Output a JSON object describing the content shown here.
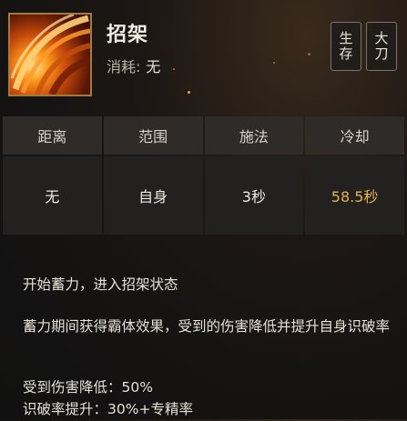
{
  "skill": {
    "name": "招架",
    "cost_label": "消耗:",
    "cost_value": "无",
    "icon": "parry-blade-icon"
  },
  "tags": [
    "生存",
    "大刀"
  ],
  "stats": {
    "headers": [
      "距离",
      "范围",
      "施法",
      "冷却"
    ],
    "values": [
      "无",
      "自身",
      "3秒",
      "58.5秒"
    ]
  },
  "description": {
    "line1": "开始蓄力，进入招架状态",
    "line2": "蓄力期间获得霸体效果，受到的伤害降低并提升自身识破率",
    "line3": "受到伤害降低：50%",
    "line4": "识破率提升：30%+专精率"
  },
  "colors": {
    "cooldown_highlight": "#e5b24d",
    "icon_frame": "#a07a3f"
  }
}
